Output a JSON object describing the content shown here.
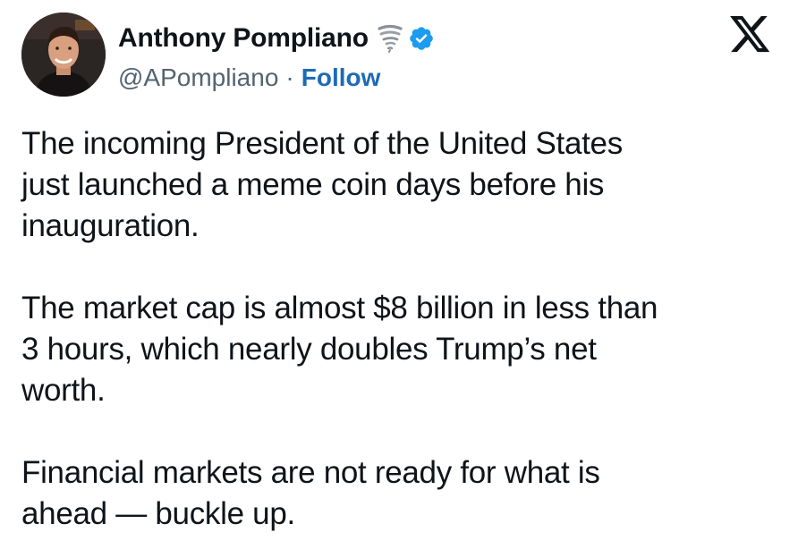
{
  "author": {
    "display_name": "Anthony Pompliano",
    "handle": "@APompliano",
    "separator": "·",
    "follow_label": "Follow",
    "emoji_icon": "tornado-icon",
    "verified_icon": "verified-badge-icon",
    "verified_color": "#1d9bf0"
  },
  "brand": {
    "logo_icon": "x-logo-icon"
  },
  "tweet": {
    "paragraphs": [
      "The incoming President of the United States\njust launched a meme coin days before his\ninauguration.",
      "The market cap is almost $8 billion in less than\n3 hours, which nearly doubles Trump’s net\nworth.",
      "Financial markets are not ready for what is\nahead — buckle up."
    ]
  },
  "colors": {
    "text": "#0f1419",
    "secondary": "#536471",
    "link": "#1d6bb5"
  }
}
